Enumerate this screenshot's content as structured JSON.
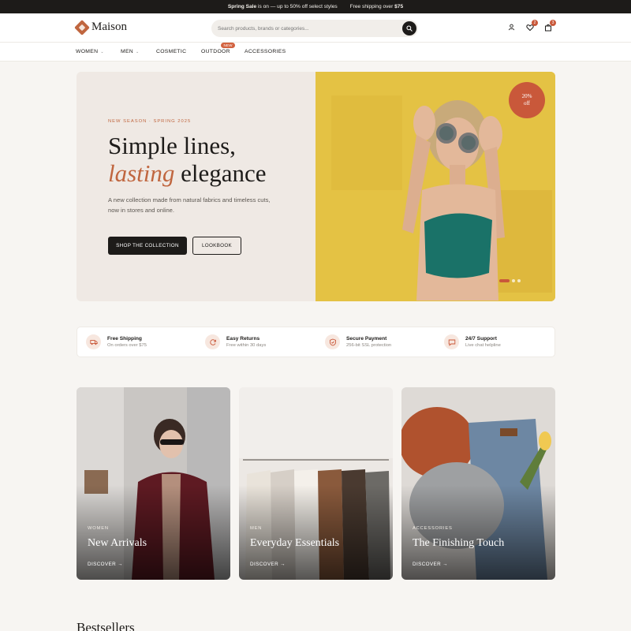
{
  "announcement": {
    "sale_bold": "Spring Sale",
    "sale_text": " is on — up to 50% off select styles",
    "shipping_text": "Free shipping over ",
    "shipping_bold": "$75"
  },
  "header": {
    "logo": "Maison",
    "search_placeholder": "Search products, brands or categories...",
    "wishlist_count": "2",
    "cart_count": "3",
    "icons": [
      "account-icon",
      "heart-icon",
      "bag-icon",
      "search-icon"
    ]
  },
  "nav": {
    "women": "WOMEN",
    "men": "MEN",
    "cosmetic": "COSMETIC",
    "outdoor": "OUTDOOR",
    "outdoor_badge": "NEW",
    "accessories": "ACCESSORIES"
  },
  "hero": {
    "eyebrow": "NEW SEASON · SPRING 2025",
    "title_line1": "Simple lines,",
    "title_em": "lasting",
    "title_rest": " elegance",
    "description": "A new collection made from natural fabrics and timeless cuts, now in stores and online.",
    "primary_button": "SHOP THE COLLECTION",
    "secondary_button": "LOOKBOOK",
    "badge_line1": "20%",
    "badge_line2": "off",
    "slide_count": 3,
    "active_slide": 1
  },
  "features": [
    {
      "title": "Free Shipping",
      "subtitle": "On orders over $75",
      "icon": "truck-icon"
    },
    {
      "title": "Easy Returns",
      "subtitle": "Free within 30 days",
      "icon": "refresh-icon"
    },
    {
      "title": "Secure Payment",
      "subtitle": "256-bit SSL protection",
      "icon": "shield-icon"
    },
    {
      "title": "24/7 Support",
      "subtitle": "Live chat helpline",
      "icon": "chat-icon"
    }
  ],
  "categories": [
    {
      "eyebrow": "WOMEN",
      "title": "New Arrivals",
      "link": "DISCOVER →"
    },
    {
      "eyebrow": "MEN",
      "title": "Everyday Essentials",
      "link": "DISCOVER →"
    },
    {
      "eyebrow": "ACCESSORIES",
      "title": "The Finishing Touch",
      "link": "DISCOVER →"
    }
  ],
  "sections": {
    "bestsellers": "Bestsellers"
  },
  "colors": {
    "accent": "#c0663f",
    "dark": "#1d1b19",
    "background": "#f7f5f2"
  }
}
